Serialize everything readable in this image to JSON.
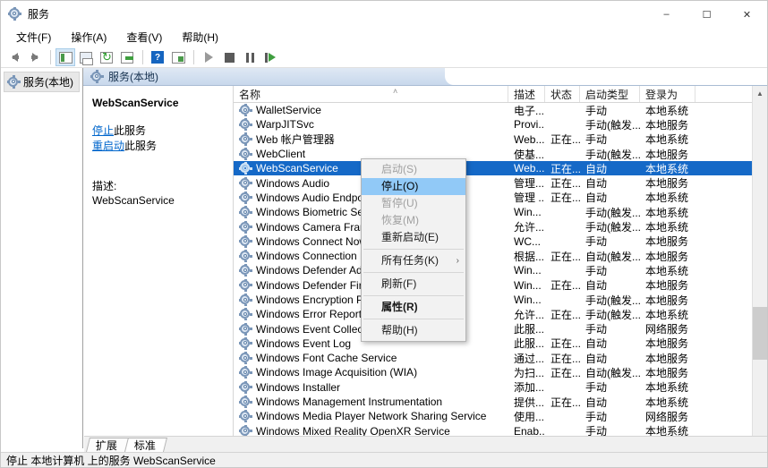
{
  "window": {
    "title": "服务",
    "icon": "services-gear-icon",
    "minimize_label": "–",
    "maximize_label": "☐",
    "close_label": "✕"
  },
  "menubar": {
    "items": [
      {
        "label": "文件(F)",
        "name": "menu-file"
      },
      {
        "label": "操作(A)",
        "name": "menu-action"
      },
      {
        "label": "查看(V)",
        "name": "menu-view"
      },
      {
        "label": "帮助(H)",
        "name": "menu-help"
      }
    ]
  },
  "toolbar": {
    "buttons": [
      {
        "name": "back-button",
        "icon": "arrow-left-icon"
      },
      {
        "name": "forward-button",
        "icon": "arrow-right-icon"
      },
      {
        "name": "show-tree-button",
        "icon": "tree-pane-icon",
        "active": true
      },
      {
        "name": "save-list-button",
        "icon": "save-icon"
      },
      {
        "name": "refresh-button",
        "icon": "refresh-icon"
      },
      {
        "name": "export-list-button",
        "icon": "export-icon"
      },
      {
        "name": "help-button",
        "icon": "question-mark-icon"
      },
      {
        "name": "properties-button",
        "icon": "properties-icon"
      },
      {
        "name": "start-service-button",
        "icon": "play-icon"
      },
      {
        "name": "stop-service-button",
        "icon": "stop-icon"
      },
      {
        "name": "pause-service-button",
        "icon": "pause-icon"
      },
      {
        "name": "restart-service-button",
        "icon": "restart-icon"
      }
    ]
  },
  "tree": {
    "root_label": "服务(本地)",
    "root_icon": "services-gear-icon"
  },
  "pane": {
    "header_label": "服务(本地)",
    "header_icon": "services-gear-icon"
  },
  "detail": {
    "title": "WebScanService",
    "stop_link_action": "停止",
    "stop_link_rest": "此服务",
    "restart_link_action": "重启动",
    "restart_link_rest": "此服务",
    "description_label": "描述:",
    "description_body": "WebScanService"
  },
  "list": {
    "sort_indicator": "˄",
    "columns": [
      {
        "key": "name",
        "label": "名称"
      },
      {
        "key": "desc",
        "label": "描述"
      },
      {
        "key": "state",
        "label": "状态"
      },
      {
        "key": "start",
        "label": "启动类型"
      },
      {
        "key": "logon",
        "label": "登录为"
      }
    ],
    "rows": [
      {
        "name": "WalletService",
        "desc": "电子...",
        "state": "",
        "start": "手动",
        "logon": "本地系统",
        "selected": false
      },
      {
        "name": "WarpJITSvc",
        "desc": "Provi...",
        "state": "",
        "start": "手动(触发...",
        "logon": "本地服务",
        "selected": false
      },
      {
        "name": "Web 帐户管理器",
        "desc": "Web...",
        "state": "正在...",
        "start": "手动",
        "logon": "本地系统",
        "selected": false
      },
      {
        "name": "WebClient",
        "desc": "使基...",
        "state": "",
        "start": "手动(触发...",
        "logon": "本地服务",
        "selected": false
      },
      {
        "name": "WebScanService",
        "desc": "Web...",
        "state": "正在...",
        "start": "自动",
        "logon": "本地系统",
        "selected": true
      },
      {
        "name": "Windows Audio",
        "desc": "管理...",
        "state": "正在...",
        "start": "自动",
        "logon": "本地服务",
        "selected": false
      },
      {
        "name": "Windows Audio Endpoint Bu...",
        "desc": "管理 ...",
        "state": "正在...",
        "start": "自动",
        "logon": "本地系统",
        "selected": false
      },
      {
        "name": "Windows Biometric Service",
        "desc": "Win...",
        "state": "",
        "start": "手动(触发...",
        "logon": "本地系统",
        "selected": false
      },
      {
        "name": "Windows Camera Frame Se...",
        "desc": "允许...",
        "state": "",
        "start": "手动(触发...",
        "logon": "本地系统",
        "selected": false
      },
      {
        "name": "Windows Connect Now - C...",
        "desc": "WC...",
        "state": "",
        "start": "手动",
        "logon": "本地服务",
        "selected": false
      },
      {
        "name": "Windows Connection Mana...",
        "desc": "根据...",
        "state": "正在...",
        "start": "自动(触发...",
        "logon": "本地服务",
        "selected": false
      },
      {
        "name": "Windows Defender Advanc...",
        "desc": "Win...",
        "state": "",
        "start": "手动",
        "logon": "本地系统",
        "selected": false
      },
      {
        "name": "Windows Defender Firewall",
        "desc": "Win...",
        "state": "正在...",
        "start": "自动",
        "logon": "本地服务",
        "selected": false
      },
      {
        "name": "Windows Encryption Provid...",
        "desc": "Win...",
        "state": "",
        "start": "手动(触发...",
        "logon": "本地服务",
        "selected": false
      },
      {
        "name": "Windows Error Reporting Se...",
        "desc": "允许...",
        "state": "正在...",
        "start": "手动(触发...",
        "logon": "本地系统",
        "selected": false
      },
      {
        "name": "Windows Event Collector",
        "desc": "此服...",
        "state": "",
        "start": "手动",
        "logon": "网络服务",
        "selected": false
      },
      {
        "name": "Windows Event Log",
        "desc": "此服...",
        "state": "正在...",
        "start": "自动",
        "logon": "本地服务",
        "selected": false
      },
      {
        "name": "Windows Font Cache Service",
        "desc": "通过...",
        "state": "正在...",
        "start": "自动",
        "logon": "本地服务",
        "selected": false
      },
      {
        "name": "Windows Image Acquisition (WIA)",
        "desc": "为扫...",
        "state": "正在...",
        "start": "自动(触发...",
        "logon": "本地服务",
        "selected": false
      },
      {
        "name": "Windows Installer",
        "desc": "添加...",
        "state": "",
        "start": "手动",
        "logon": "本地系统",
        "selected": false
      },
      {
        "name": "Windows Management Instrumentation",
        "desc": "提供...",
        "state": "正在...",
        "start": "自动",
        "logon": "本地系统",
        "selected": false
      },
      {
        "name": "Windows Media Player Network Sharing Service",
        "desc": "使用...",
        "state": "",
        "start": "手动",
        "logon": "网络服务",
        "selected": false
      },
      {
        "name": "Windows Mixed Reality OpenXR Service",
        "desc": "Enab...",
        "state": "",
        "start": "手动",
        "logon": "本地系统",
        "selected": false
      }
    ]
  },
  "scrollbar": {
    "up_arrow": "▲",
    "down_arrow": "▼",
    "thumb_top_pct": 62,
    "thumb_height_pct": 16
  },
  "context_menu": {
    "items": [
      {
        "label": "启动(S)",
        "name": "ctx-start",
        "disabled": true,
        "highlighted": false,
        "bold": false,
        "submenu": false
      },
      {
        "label": "停止(O)",
        "name": "ctx-stop",
        "disabled": false,
        "highlighted": true,
        "bold": false,
        "submenu": false
      },
      {
        "label": "暂停(U)",
        "name": "ctx-pause",
        "disabled": true,
        "highlighted": false,
        "bold": false,
        "submenu": false
      },
      {
        "label": "恢复(M)",
        "name": "ctx-resume",
        "disabled": true,
        "highlighted": false,
        "bold": false,
        "submenu": false
      },
      {
        "label": "重新启动(E)",
        "name": "ctx-restart",
        "disabled": false,
        "highlighted": false,
        "bold": false,
        "submenu": false
      },
      {
        "separator": true
      },
      {
        "label": "所有任务(K)",
        "name": "ctx-all-tasks",
        "disabled": false,
        "highlighted": false,
        "bold": false,
        "submenu": true,
        "submenu_glyph": "›"
      },
      {
        "separator": true
      },
      {
        "label": "刷新(F)",
        "name": "ctx-refresh",
        "disabled": false,
        "highlighted": false,
        "bold": false,
        "submenu": false
      },
      {
        "separator": true
      },
      {
        "label": "属性(R)",
        "name": "ctx-properties",
        "disabled": false,
        "highlighted": false,
        "bold": true,
        "submenu": false
      },
      {
        "separator": true
      },
      {
        "label": "帮助(H)",
        "name": "ctx-help",
        "disabled": false,
        "highlighted": false,
        "bold": false,
        "submenu": false
      }
    ]
  },
  "tabs": [
    {
      "label": "扩展",
      "name": "tab-extended",
      "active": false
    },
    {
      "label": "标准",
      "name": "tab-standard",
      "active": true
    }
  ],
  "statusbar": {
    "text": "停止 本地计算机 上的服务 WebScanService"
  },
  "colors": {
    "selection": "#1569c7",
    "menu_highlight": "#91c9f7",
    "link": "#0066cc",
    "pane_header_start": "#dfe8f4",
    "pane_header_end": "#c8d8ec"
  }
}
